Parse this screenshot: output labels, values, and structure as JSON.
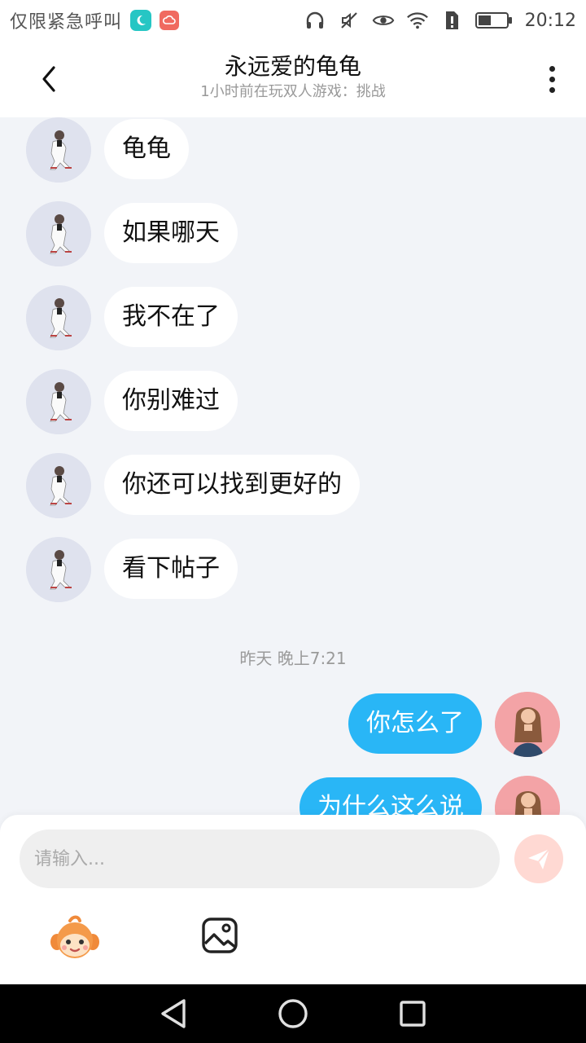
{
  "status_bar": {
    "emergency_text": "仅限紧急呼叫",
    "time": "20:12"
  },
  "header": {
    "title": "永远爱的龟龟",
    "subtitle": "1小时前在玩双人游戏：挑战"
  },
  "messages": [
    {
      "side": "left",
      "text": "龟龟"
    },
    {
      "side": "left",
      "text": "如果哪天"
    },
    {
      "side": "left",
      "text": "我不在了"
    },
    {
      "side": "left",
      "text": "你别难过"
    },
    {
      "side": "left",
      "text": "你还可以找到更好的"
    },
    {
      "side": "left",
      "text": "看下帖子"
    },
    {
      "side": "right",
      "text": "你怎么了"
    },
    {
      "side": "right",
      "text": "为什么这么说"
    }
  ],
  "timestamp": "昨天 晚上7:21",
  "input": {
    "placeholder": "请输入..."
  },
  "colors": {
    "bubble_self": "#29b6f6",
    "bubble_other": "#ffffff",
    "chat_background": "#f2f4f8",
    "send_button": "#ffd9d3"
  },
  "icons": [
    "back-icon",
    "more-icon",
    "emoji-icon",
    "image-icon",
    "send-icon",
    "nav-back-icon",
    "nav-home-icon",
    "nav-recents-icon"
  ]
}
